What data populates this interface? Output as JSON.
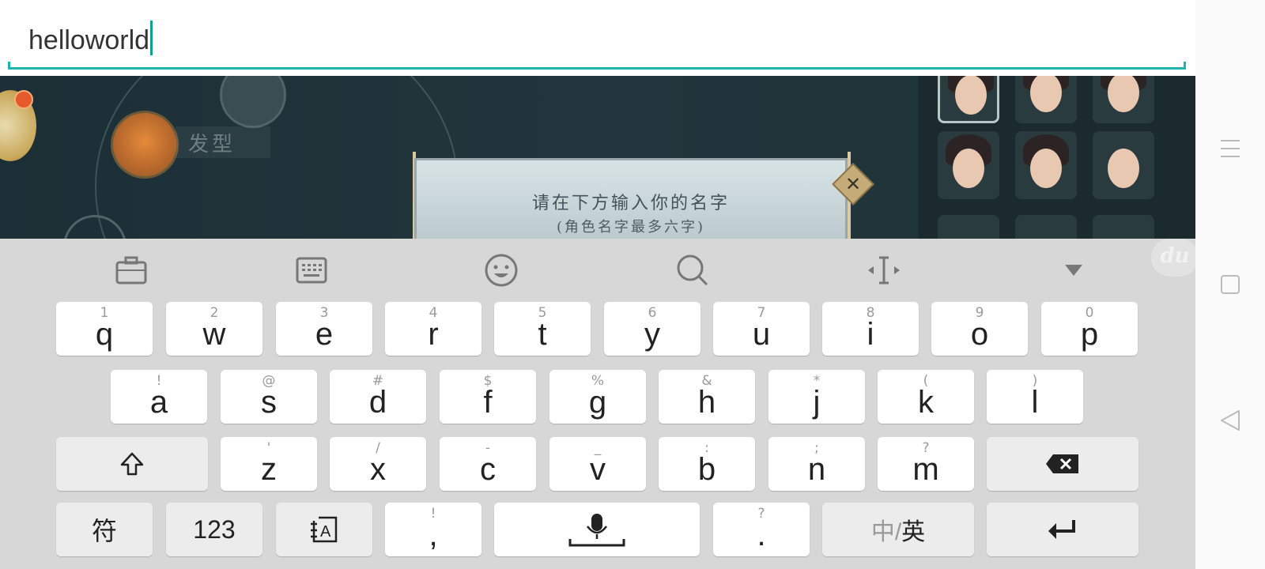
{
  "input": {
    "value": "helloworld"
  },
  "game": {
    "hair_label": "发型",
    "dialog_title": "请在下方输入你的名字",
    "dialog_sub": "(角色名字最多六字)"
  },
  "keyboard": {
    "logo": "du",
    "row1": [
      {
        "alt": "1",
        "main": "q"
      },
      {
        "alt": "2",
        "main": "w"
      },
      {
        "alt": "3",
        "main": "e"
      },
      {
        "alt": "4",
        "main": "r"
      },
      {
        "alt": "5",
        "main": "t"
      },
      {
        "alt": "6",
        "main": "y"
      },
      {
        "alt": "7",
        "main": "u"
      },
      {
        "alt": "8",
        "main": "i"
      },
      {
        "alt": "9",
        "main": "o"
      },
      {
        "alt": "0",
        "main": "p"
      }
    ],
    "row2": [
      {
        "alt": "!",
        "main": "a"
      },
      {
        "alt": "@",
        "main": "s"
      },
      {
        "alt": "#",
        "main": "d"
      },
      {
        "alt": "$",
        "main": "f"
      },
      {
        "alt": "%",
        "main": "g"
      },
      {
        "alt": "&",
        "main": "h"
      },
      {
        "alt": "*",
        "main": "j"
      },
      {
        "alt": "(",
        "main": "k"
      },
      {
        "alt": ")",
        "main": "l"
      }
    ],
    "row3": [
      {
        "alt": "'",
        "main": "z"
      },
      {
        "alt": "/",
        "main": "x"
      },
      {
        "alt": "-",
        "main": "c"
      },
      {
        "alt": "_",
        "main": "v"
      },
      {
        "alt": ":",
        "main": "b"
      },
      {
        "alt": ";",
        "main": "n"
      },
      {
        "alt": "?",
        "main": "m"
      }
    ],
    "bottom": {
      "symbols": "符",
      "numbers": "123",
      "comma": ",",
      "comma_alt": "!",
      "period": ".",
      "period_alt": "?",
      "lang_zh": "中/",
      "lang_en": "英"
    }
  }
}
